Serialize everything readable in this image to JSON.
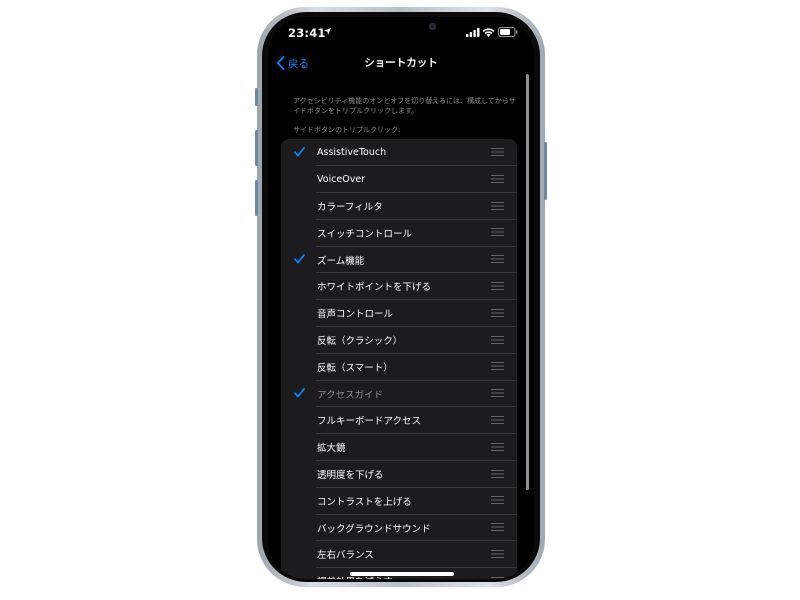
{
  "status_bar": {
    "time": "23:41"
  },
  "nav": {
    "back_label": "戻る",
    "title": "ショートカット"
  },
  "description": "アクセシビリティ機能のオンとオフを切り替えるには、構成してからサイドボタンをトリプルクリックします。",
  "section_header": "サイドボタンのトリプルクリック:",
  "items": [
    {
      "label": "AssistiveTouch",
      "checked": true,
      "dimmed": false
    },
    {
      "label": "VoiceOver",
      "checked": false,
      "dimmed": false
    },
    {
      "label": "カラーフィルタ",
      "checked": false,
      "dimmed": false
    },
    {
      "label": "スイッチコントロール",
      "checked": false,
      "dimmed": false
    },
    {
      "label": "ズーム機能",
      "checked": true,
      "dimmed": false
    },
    {
      "label": "ホワイトポイントを下げる",
      "checked": false,
      "dimmed": false
    },
    {
      "label": "音声コントロール",
      "checked": false,
      "dimmed": false
    },
    {
      "label": "反転（クラシック）",
      "checked": false,
      "dimmed": false
    },
    {
      "label": "反転（スマート）",
      "checked": false,
      "dimmed": false
    },
    {
      "label": "アクセスガイド",
      "checked": true,
      "dimmed": true
    },
    {
      "label": "フルキーボードアクセス",
      "checked": false,
      "dimmed": false
    },
    {
      "label": "拡大鏡",
      "checked": false,
      "dimmed": false
    },
    {
      "label": "透明度を下げる",
      "checked": false,
      "dimmed": false
    },
    {
      "label": "コントラストを上げる",
      "checked": false,
      "dimmed": false
    },
    {
      "label": "バックグラウンドサウンド",
      "checked": false,
      "dimmed": false
    },
    {
      "label": "左右バランス",
      "checked": false,
      "dimmed": false
    },
    {
      "label": "視差効果を減らす",
      "checked": false,
      "dimmed": false
    }
  ],
  "colors": {
    "accent": "#0a84ff",
    "background": "#000000",
    "cell_background": "#1c1c1e",
    "secondary_text": "#8e8e93"
  },
  "icons": {
    "back": "chevron-left-icon",
    "check": "checkmark-icon",
    "reorder": "reorder-handle-icon",
    "location": "location-arrow-icon",
    "signal": "cellular-signal-icon",
    "wifi": "wifi-icon",
    "battery": "battery-icon"
  }
}
